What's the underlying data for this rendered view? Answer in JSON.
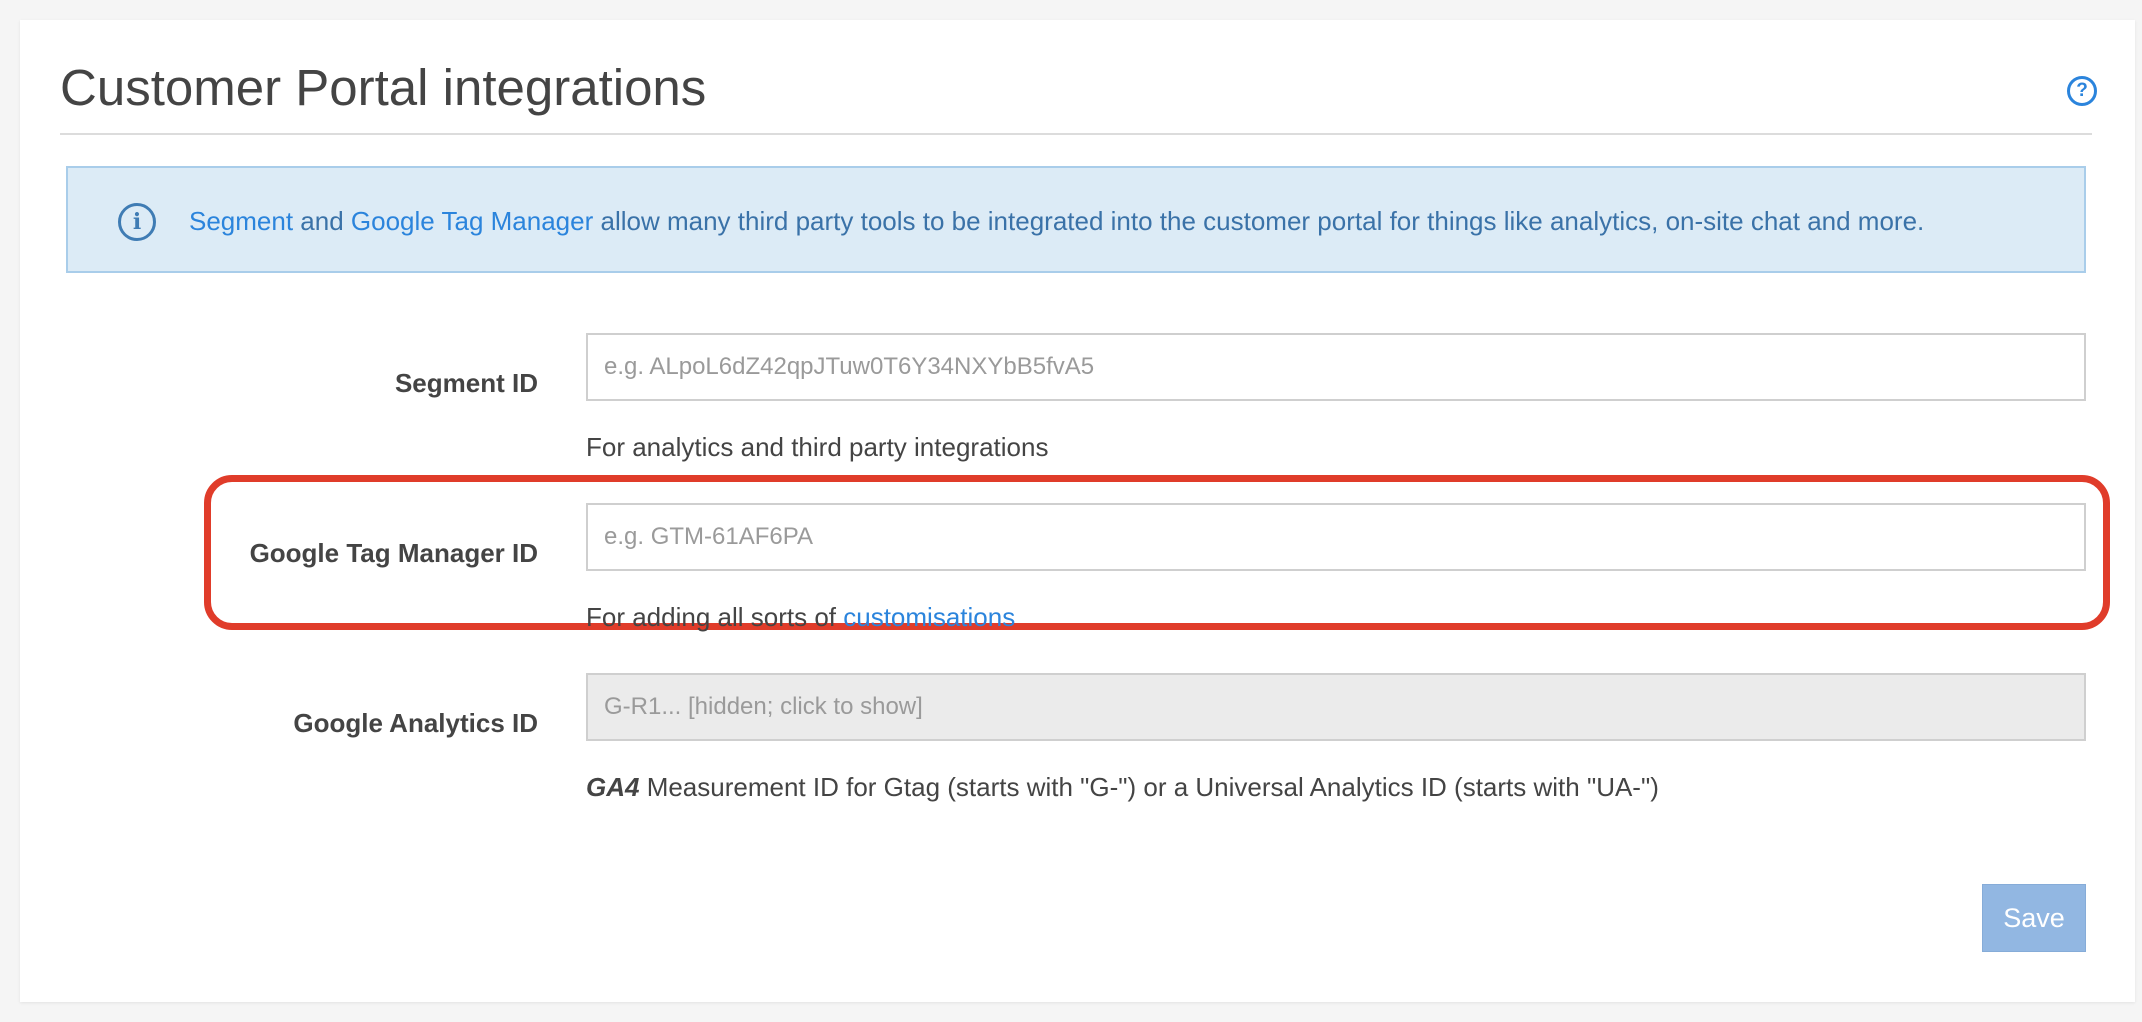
{
  "page": {
    "title": "Customer Portal integrations",
    "help_icon": "question-circle-icon"
  },
  "info": {
    "icon": "info-circle-icon",
    "link_segment": "Segment",
    "and": " and ",
    "link_gtm": "Google Tag Manager",
    "text": " allow many third party tools to be integrated into the customer portal for things like analytics, on-site chat and more."
  },
  "fields": {
    "segment": {
      "label": "Segment ID",
      "placeholder": "e.g. ALpoL6dZ42qpJTuw0T6Y34NXYbB5fvA5",
      "help": "For analytics and third party integrations"
    },
    "gtm": {
      "label": "Google Tag Manager ID",
      "placeholder": "e.g. GTM-61AF6PA",
      "help_prefix": "For adding all sorts of ",
      "help_link": "customisations"
    },
    "ga": {
      "label": "Google Analytics ID",
      "placeholder": "G-R1... [hidden; click to show]",
      "help_em": "GA4",
      "help": " Measurement ID for Gtag (starts with \"G-\") or a Universal Analytics ID (starts with \"UA-\")"
    }
  },
  "actions": {
    "save_label": "Save"
  },
  "colors": {
    "accent": "#2b84dc",
    "highlight": "#e03c2a",
    "info_bg": "#dcebf6",
    "save_bg": "#92b7e2"
  }
}
